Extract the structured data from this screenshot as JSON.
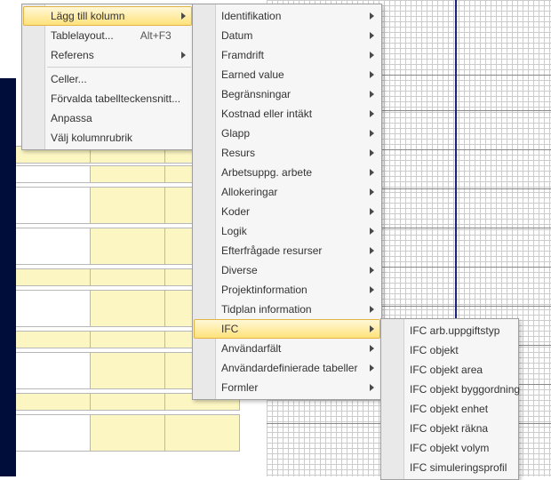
{
  "menu1": {
    "items": [
      {
        "label": "Lägg till kolumn",
        "submenu": true,
        "shortcut": "",
        "hovered": true
      },
      {
        "label": "Tablelayout...",
        "submenu": false,
        "shortcut": "Alt+F3"
      },
      {
        "label": "Referens",
        "submenu": true,
        "shortcut": ""
      },
      {
        "sep": true
      },
      {
        "label": "Celler...",
        "submenu": false,
        "shortcut": ""
      },
      {
        "label": "Förvalda tabellteckensnitt...",
        "submenu": false,
        "shortcut": ""
      },
      {
        "label": "Anpassa",
        "submenu": false,
        "shortcut": ""
      },
      {
        "label": "Välj kolumnrubrik",
        "submenu": false,
        "shortcut": ""
      }
    ]
  },
  "menu2": {
    "items": [
      {
        "label": "Identifikation",
        "submenu": true
      },
      {
        "label": "Datum",
        "submenu": true
      },
      {
        "label": "Framdrift",
        "submenu": true
      },
      {
        "label": "Earned value",
        "submenu": true
      },
      {
        "label": "Begränsningar",
        "submenu": true
      },
      {
        "label": "Kostnad eller intäkt",
        "submenu": true
      },
      {
        "label": "Glapp",
        "submenu": true
      },
      {
        "label": "Resurs",
        "submenu": true
      },
      {
        "label": "Arbetsuppg. arbete",
        "submenu": true
      },
      {
        "label": "Allokeringar",
        "submenu": true
      },
      {
        "label": "Koder",
        "submenu": true
      },
      {
        "label": "Logik",
        "submenu": true
      },
      {
        "label": "Efterfrågade resurser",
        "submenu": true
      },
      {
        "label": "Diverse",
        "submenu": true
      },
      {
        "label": "Projektinformation",
        "submenu": true
      },
      {
        "label": "Tidplan information",
        "submenu": true
      },
      {
        "label": "IFC",
        "submenu": true,
        "hovered": true
      },
      {
        "label": "Användarfält",
        "submenu": true
      },
      {
        "label": "Användardefinierade tabeller",
        "submenu": true
      },
      {
        "label": "Formler",
        "submenu": true
      }
    ]
  },
  "menu3": {
    "items": [
      {
        "label": "IFC arb.uppgiftstyp"
      },
      {
        "label": "IFC objekt"
      },
      {
        "label": "IFC objekt area"
      },
      {
        "label": "IFC objekt byggordning"
      },
      {
        "label": "IFC objekt enhet"
      },
      {
        "label": "IFC objekt räkna"
      },
      {
        "label": "IFC objekt volym"
      },
      {
        "label": "IFC simuleringsprofil"
      }
    ]
  }
}
